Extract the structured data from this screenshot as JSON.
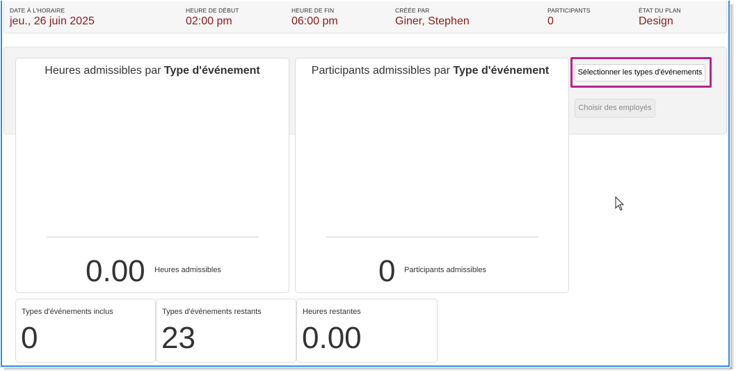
{
  "header": {
    "date_label": "DATE À L'HORAIRE",
    "date_value": "jeu., 26 juin 2025",
    "start_label": "HEURE DE DÉBUT",
    "start_value": "02:00 pm",
    "end_label": "HEURE DE FIN",
    "end_value": "06:00 pm",
    "created_label": "CRÉÉE PAR",
    "created_value": "Giner, Stephen",
    "participants_label": "PARTICIPANTS",
    "participants_value": "0",
    "plan_state_label": "ÉTAT DU PLAN",
    "plan_state_value": "Design"
  },
  "hours_card": {
    "title_prefix": "Heures admissibles par ",
    "title_bold": "Type d'événement",
    "value": "0.00",
    "value_label": "Heures admissibles"
  },
  "participants_card": {
    "title_prefix": "Participants admissibles par ",
    "title_bold": "Type d'événement",
    "value": "0",
    "value_label": "Participants admissibles"
  },
  "buttons": {
    "select_event_types": "Sélectionner les types d'événements",
    "choose_employees": "Choisir des employés"
  },
  "stats": [
    {
      "label": "Types d'événements inclus",
      "value": "0"
    },
    {
      "label": "Types d'événements restants",
      "value": "23"
    },
    {
      "label": "Heures restantes",
      "value": "0.00"
    }
  ],
  "colors": {
    "header_value": "#8b1a1a",
    "highlight_border": "#b5258e",
    "window_border": "#2a8ee0"
  }
}
